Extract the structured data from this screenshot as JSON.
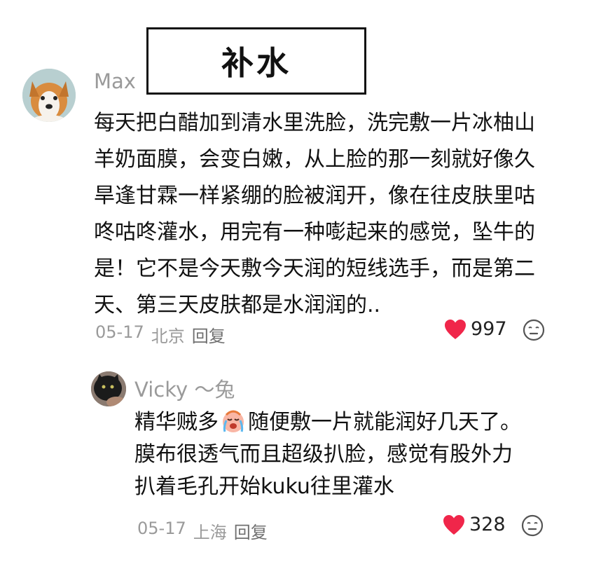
{
  "title_box": {
    "text": "补水"
  },
  "comment": {
    "username": "Max",
    "lines": [
      "每天把白醋加到清水里洗脸，洗完敷一片冰柚山",
      "羊奶面膜，会变白嫩，从上脸的那一刻就好像久",
      "旱逢甘霖一样紧绷的脸被润开，像在往皮肤里咕",
      "咚咕咚灌水，用完有一种嘭起来的感觉，坠牛的",
      "是！它不是今天敷今天润的短线选手，而是第二",
      "天、第三天皮肤都是水润润的.."
    ],
    "date": "05-17",
    "location": "北京",
    "reply_label": "回复",
    "likes": "997"
  },
  "reply": {
    "username": "Vicky ～兔",
    "line1_before": "精华贼多",
    "line1_after": "随便敷一片就能润好几天了。",
    "line2": "膜布很透气而且超级扒脸，感觉有股外力",
    "line3": "扒着毛孔开始kuku往里灌水",
    "emoji_icon": "crying-face-emoji",
    "date": "05-17",
    "location": "上海",
    "reply_label": "回复",
    "likes": "328"
  },
  "colors": {
    "heart": "#f0264a",
    "meta_text": "#9a9a9a",
    "body_text": "#111111"
  }
}
